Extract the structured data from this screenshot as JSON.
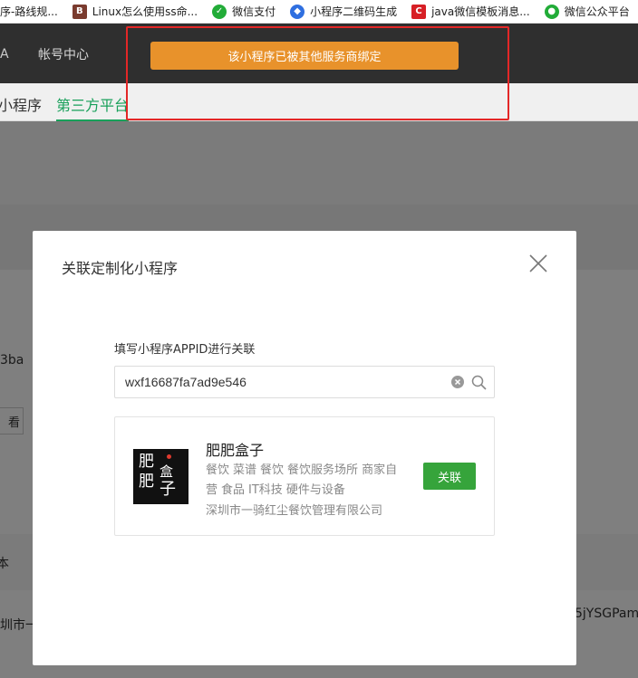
{
  "bookmarks": [
    {
      "label": "序-路线规...",
      "icon": "page-icon",
      "color": "#f0f0f0"
    },
    {
      "label": "Linux怎么使用ss命...",
      "icon": "b-logo-icon",
      "color": "#7a3b2e"
    },
    {
      "label": "微信支付",
      "icon": "wechat-pay-icon",
      "color": "#22ac38"
    },
    {
      "label": "小程序二维码生成",
      "icon": "compass-icon",
      "color": "#2f6fe0"
    },
    {
      "label": "java微信模板消息...",
      "icon": "csdn-icon",
      "color": "#d71f25"
    },
    {
      "label": "微信公众平台",
      "icon": "wechat-icon",
      "color": "#22ac38"
    }
  ],
  "topnav": {
    "left_fragment": "A",
    "account_center": "帐号中心"
  },
  "toast": "该小程序已被其他服务商绑定",
  "subtabs": {
    "miniprogram": "小程序",
    "third_party": "第三方平台"
  },
  "background": {
    "id_fragment": "3ba",
    "button_fragment": "看",
    "col_fragment": "本",
    "company_fragment": "圳市一",
    "right_fragment": "5jYSGPam-"
  },
  "modal": {
    "title": "关联定制化小程序",
    "field_label": "填写小程序APPID进行关联",
    "appid_value": "wxf16687fa7ad9e546",
    "result": {
      "name": "肥肥盒子",
      "logo_text": {
        "c1": "肥",
        "c2": "肥",
        "c3": "盒",
        "c4": "子"
      },
      "tags": [
        "餐饮",
        "菜谱",
        "餐饮",
        "餐饮服务场所",
        "商家自营",
        "食品",
        "IT科技",
        "硬件与设备"
      ],
      "company": "深圳市一骑红尘餐饮管理有限公司",
      "link_button": "关联"
    }
  },
  "colors": {
    "toast": "#e8922b",
    "active_tab": "#18a05a",
    "primary_button": "#36a43b",
    "highlight_box": "#e32727"
  }
}
